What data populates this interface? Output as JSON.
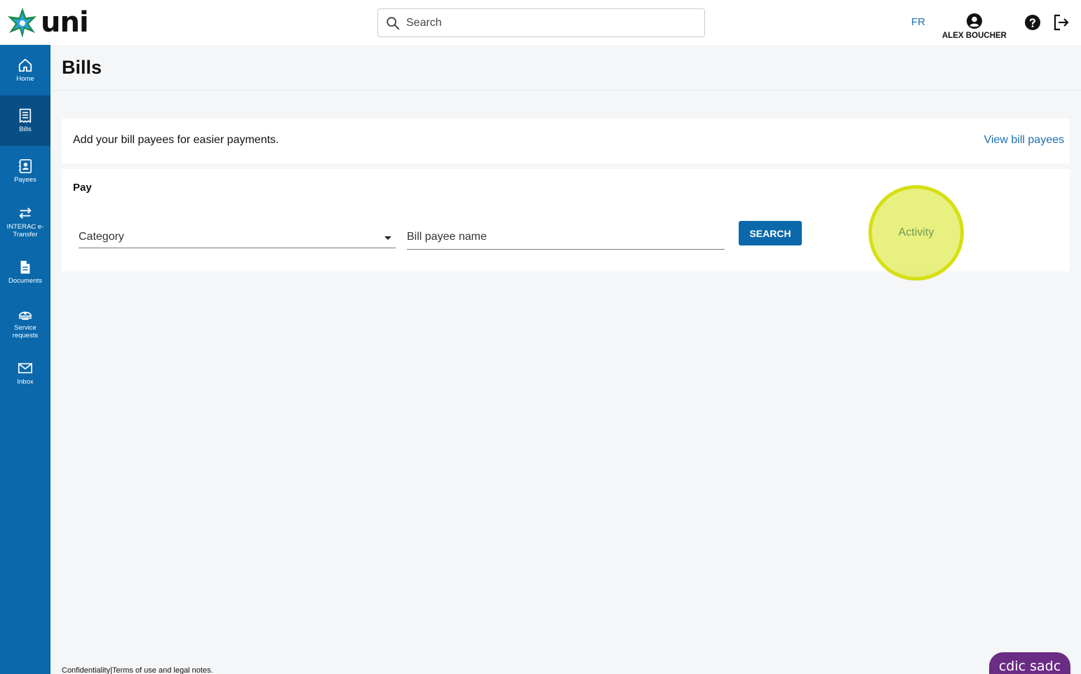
{
  "header": {
    "logo_text": "uni",
    "search_placeholder": "Search",
    "language_toggle": "FR",
    "user_name": "ALEX BOUCHER"
  },
  "sidebar": {
    "items": [
      {
        "label": "Home",
        "icon": "home-icon"
      },
      {
        "label": "Bills",
        "icon": "bills-icon",
        "active": true
      },
      {
        "label": "Payees",
        "icon": "payees-icon"
      },
      {
        "label": "INTERAC e-Transfer",
        "icon": "transfer-icon"
      },
      {
        "label": "Documents",
        "icon": "document-icon"
      },
      {
        "label": "Service requests",
        "icon": "service-icon"
      },
      {
        "label": "Inbox",
        "icon": "inbox-icon"
      }
    ]
  },
  "page": {
    "title": "Bills"
  },
  "info_card": {
    "text": "Add your bill payees for easier payments.",
    "link": "View bill payees"
  },
  "pay_card": {
    "title": "Pay",
    "category_placeholder": "Category",
    "payee_placeholder": "Bill payee name",
    "search_button": "SEARCH",
    "activity_link": "Activity"
  },
  "footer": {
    "confidentiality": "Confidentiality",
    "separator": "|",
    "terms": "Terms of use and legal notes.",
    "badge": "cdic sadc"
  },
  "colors": {
    "brand_blue": "#0a68ab",
    "active_nav": "#084f86",
    "link_blue": "#1a6fb0",
    "highlight": "#d6df12",
    "cdic_purple": "#6b2c84"
  }
}
